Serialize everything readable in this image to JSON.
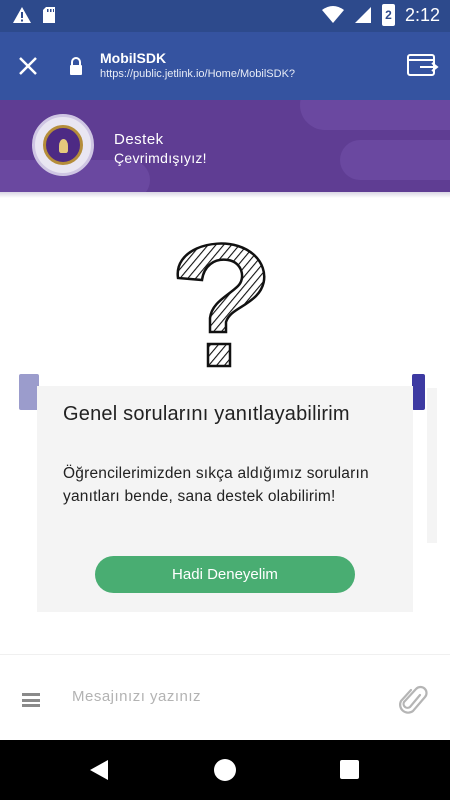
{
  "status_bar": {
    "time": "2:12",
    "battery_level": "2",
    "icons": [
      "warning-icon",
      "sd-card-icon",
      "wifi-icon",
      "signal-icon",
      "battery-icon"
    ]
  },
  "app_bar": {
    "title": "MobilSDK",
    "url": "https://public.jetlink.io/Home/MobilSDK?",
    "icons": [
      "close-icon",
      "lock-icon",
      "open-in-browser-icon"
    ]
  },
  "chat_header": {
    "title": "Destek",
    "status": "Çevrimdışıyız!"
  },
  "card": {
    "title": "Genel sorularını yanıtlayabilirim",
    "text": "Öğrencilerimizden sıkça aldığımız soruların yanıtları bende, sana destek olabilirim!",
    "button_label": "Hadi Deneyelim"
  },
  "input_bar": {
    "placeholder": "Mesajınızı yazınız"
  },
  "colors": {
    "status_bar": "#2d4a8c",
    "app_bar": "#3553a0",
    "header": "#5f3d93",
    "button": "#49ad72",
    "card": "#f4f4f4"
  }
}
